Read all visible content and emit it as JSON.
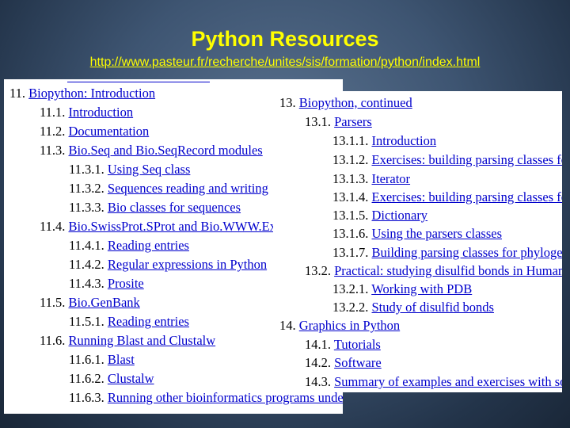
{
  "slide": {
    "title": "Python Resources",
    "url": "http://www.pasteur.fr/recherche/unites/sis/formation/python/index.html"
  },
  "left_panel": {
    "items": [
      {
        "num": "11.",
        "label": "Biopython: Introduction"
      },
      {
        "num": "11.1.",
        "label": "Introduction"
      },
      {
        "num": "11.2.",
        "label": "Documentation"
      },
      {
        "num": "11.3.",
        "label": "Bio.Seq and Bio.SeqRecord modules"
      },
      {
        "num": "11.3.1.",
        "label": "Using Seq class"
      },
      {
        "num": "11.3.2.",
        "label": "Sequences reading and writing"
      },
      {
        "num": "11.3.3.",
        "label": "Bio classes for sequences"
      },
      {
        "num": "11.4.",
        "label": "Bio.SwissProt.SProt and Bio.WWW.ExPASy"
      },
      {
        "num": "11.4.1.",
        "label": "Reading entries"
      },
      {
        "num": "11.4.2.",
        "label": "Regular expressions in Python"
      },
      {
        "num": "11.4.3.",
        "label": "Prosite"
      },
      {
        "num": "11.5.",
        "label": "Bio.GenBank"
      },
      {
        "num": "11.5.1.",
        "label": "Reading entries"
      },
      {
        "num": "11.6.",
        "label": "Running Blast and Clustalw"
      },
      {
        "num": "11.6.1.",
        "label": "Blast"
      },
      {
        "num": "11.6.2.",
        "label": "Clustalw"
      },
      {
        "num": "11.6.3.",
        "label": "Running other bioinformatics programs under Pise"
      }
    ]
  },
  "right_panel": {
    "items": [
      {
        "num": "13.",
        "label": "Biopython, continued"
      },
      {
        "num": "13.1.",
        "label": "Parsers"
      },
      {
        "num": "13.1.1.",
        "label": "Introduction"
      },
      {
        "num": "13.1.2.",
        "label": "Exercises: building parsing classes for Enzyme"
      },
      {
        "num": "13.1.3.",
        "label": "Iterator"
      },
      {
        "num": "13.1.4.",
        "label": "Exercises: building parsing classes for Enzyme"
      },
      {
        "num": "13.1.5.",
        "label": "Dictionary"
      },
      {
        "num": "13.1.6.",
        "label": "Using the parsers classes"
      },
      {
        "num": "13.1.7.",
        "label": "Building parsing classes for phylogenetic trees"
      },
      {
        "num": "13.2.",
        "label": "Practical: studying disulfid bonds in Human Ferroxidase"
      },
      {
        "num": "13.2.1.",
        "label": "Working with PDB"
      },
      {
        "num": "13.2.2.",
        "label": "Study of disulfid bonds"
      },
      {
        "num": "14.",
        "label": "Graphics in Python"
      },
      {
        "num": "14.1.",
        "label": "Tutorials"
      },
      {
        "num": "14.2.",
        "label": "Software"
      },
      {
        "num": "14.3.",
        "label": "Summary of examples and exercises with some graphics"
      }
    ]
  }
}
